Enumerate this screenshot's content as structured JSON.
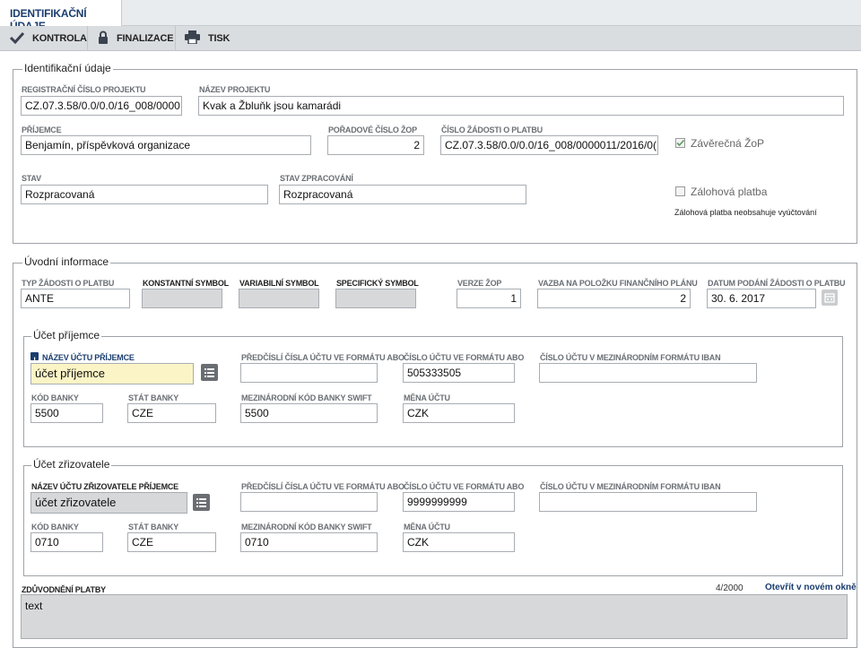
{
  "tabs": {
    "active": "IDENTIFIKAČNÍ ÚDAJE"
  },
  "toolbar": {
    "kontrola": "KONTROLA",
    "finalizace": "FINALIZACE",
    "tisk": "TISK"
  },
  "ident": {
    "legend": "Identifikační údaje",
    "reg_label": "REGISTRAČNÍ ČÍSLO PROJEKTU",
    "reg_value": "CZ.07.3.58/0.0/0.0/16_008/0000",
    "nazev_label": "NÁZEV PROJEKTU",
    "nazev_value": "Kvak a Žbluňk jsou kamarádi",
    "prijemce_label": "PŘÍJEMCE",
    "prijemce_value": "Benjamín, příspěvková organizace",
    "poradove_label": "POŘADOVÉ ČÍSLO ŽOP",
    "poradove_value": "2",
    "cislo_zadosti_label": "ČÍSLO ŽÁDOSTI O PLATBU",
    "cislo_zadosti_value": "CZ.07.3.58/0.0/0.0/16_008/0000011/2016/0(",
    "zaverecna_label": "Závěrečná ŽoP",
    "stav_label": "STAV",
    "stav_value": "Rozpracovaná",
    "stav_zprac_label": "STAV ZPRACOVÁNÍ",
    "stav_zprac_value": "Rozpracovaná",
    "zalohova_label": "Zálohová platba",
    "zalohova_note": "Zálohová platba neobsahuje vyúčtování"
  },
  "uvod": {
    "legend": "Úvodní informace",
    "typ_label": "TYP ŽÁDOSTI O PLATBU",
    "typ_value": "ANTE",
    "konst_label": "KONSTANTNÍ SYMBOL",
    "var_label": "VARIABILNÍ SYMBOL",
    "spec_label": "SPECIFICKÝ SYMBOL",
    "verze_label": "VERZE ŽOP",
    "verze_value": "1",
    "vazba_label": "VAZBA NA POLOŽKU FINANČNÍHO PLÁNU",
    "vazba_value": "2",
    "datum_label": "DATUM PODÁNÍ ŽÁDOSTI O PLATBU",
    "datum_value": "30. 6. 2017"
  },
  "ucet_prijemce": {
    "legend": "Účet příjemce",
    "nazev_label": "NÁZEV ÚČTU PŘÍJEMCE",
    "nazev_value": "účet příjemce",
    "predcisli_label": "PŘEDČÍSLÍ ČÍSLA ÚČTU VE FORMÁTU ABO",
    "predcisli_value": "",
    "cislo_label": "ČÍSLO ÚČTU VE FORMÁTU ABO",
    "cislo_value": "505333505",
    "iban_label": "ČÍSLO ÚČTU V MEZINÁRODNÍM FORMÁTU IBAN",
    "iban_value": "",
    "kod_label": "KÓD BANKY",
    "kod_value": "5500",
    "stat_label": "STÁT BANKY",
    "stat_value": "CZE",
    "swift_label": "MEZINÁRODNÍ KÓD BANKY SWIFT",
    "swift_value": "5500",
    "mena_label": "MĚNA ÚČTU",
    "mena_value": "CZK"
  },
  "ucet_zrizovatele": {
    "legend": "Účet zřizovatele",
    "nazev_label": "NÁZEV ÚČTU ZŘIZOVATELE PŘÍJEMCE",
    "nazev_value": "účet zřizovatele",
    "predcisli_label": "PŘEDČÍSLÍ ČÍSLA ÚČTU VE FORMÁTU ABO",
    "predcisli_value": "",
    "cislo_label": "ČÍSLO ÚČTU VE FORMÁTU ABO",
    "cislo_value": "9999999999",
    "iban_label": "ČÍSLO ÚČTU V MEZINÁRODNÍM FORMÁTU IBAN",
    "iban_value": "",
    "kod_label": "KÓD BANKY",
    "kod_value": "0710",
    "stat_label": "STÁT BANKY",
    "stat_value": "CZE",
    "swift_label": "MEZINÁRODNÍ KÓD BANKY SWIFT",
    "swift_value": "0710",
    "mena_label": "MĚNA ÚČTU",
    "mena_value": "CZK"
  },
  "zduvodneni": {
    "label": "ZDŮVODNĚNÍ PLATBY",
    "counter": "4/2000",
    "open_link": "Otevřít v novém okně",
    "value": "text"
  },
  "colors": {
    "accent": "#1a3d6e",
    "required_bg": "#fbf4c6",
    "readonly_bg": "#d7d8d9"
  },
  "icons": [
    "check-icon",
    "lock-icon",
    "printer-icon",
    "calendar-icon",
    "list-icon",
    "info-icon"
  ]
}
